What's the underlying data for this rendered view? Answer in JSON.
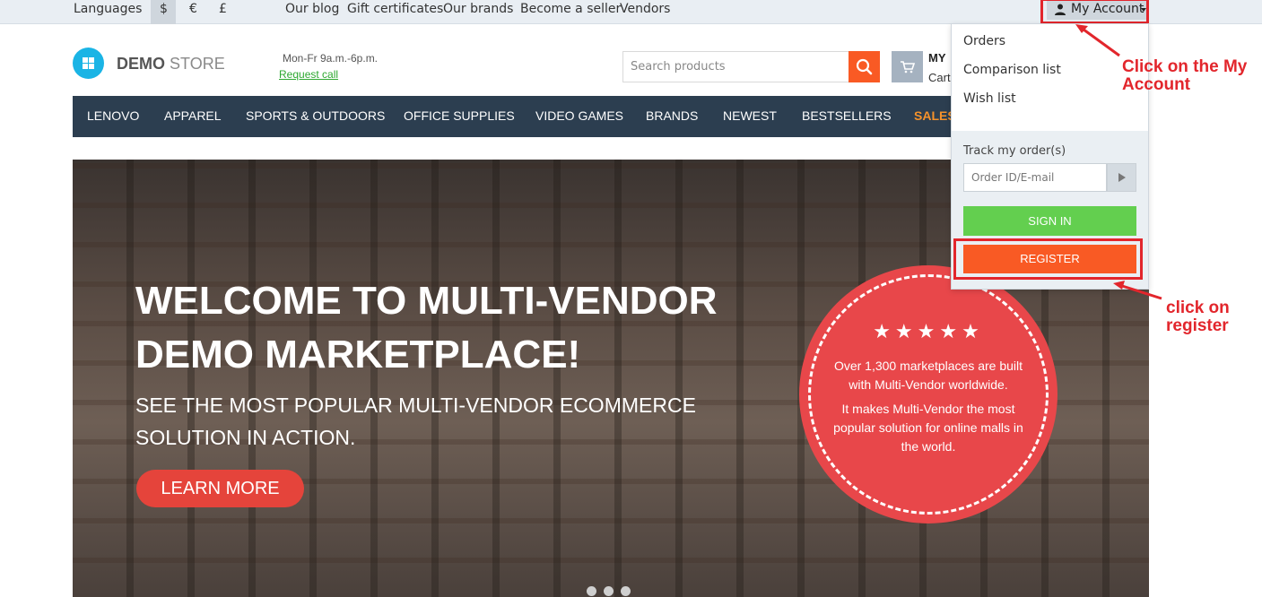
{
  "topbar": {
    "languages": "Languages",
    "currencies": [
      "$",
      "€",
      "£"
    ],
    "links": [
      "Our blog",
      "Gift certificates",
      "Our brands",
      "Become a seller",
      "Vendors"
    ],
    "my_account": "My Account"
  },
  "header": {
    "logo_bold": "DEMO",
    "logo_light": "STORE",
    "hours": "Mon-Fr 9a.m.-6p.m.",
    "request_call": "Request call",
    "search_placeholder": "Search products",
    "cart_title": "MY",
    "cart_sub": "Cart"
  },
  "nav": [
    "LENOVO",
    "APPAREL",
    "SPORTS & OUTDOORS",
    "OFFICE SUPPLIES",
    "VIDEO GAMES",
    "BRANDS",
    "NEWEST",
    "BESTSELLERS",
    "SALES"
  ],
  "hero": {
    "title_line1": "WELCOME TO MULTI-VENDOR",
    "title_line2": "DEMO MARKETPLACE!",
    "subtitle_line1": "SEE THE MOST POPULAR MULTI-VENDOR ECOMMERCE",
    "subtitle_line2": "SOLUTION IN ACTION.",
    "button": "LEARN MORE",
    "badge_stars": "★★★★★",
    "badge_text1": "Over 1,300 marketplaces are built with Multi-Vendor worldwide.",
    "badge_text2": "It makes Multi-Vendor the most popular solution for online malls in the world.",
    "slide_count": 3
  },
  "dropdown": {
    "links": [
      "Orders",
      "Comparison list",
      "Wish list"
    ],
    "track_label": "Track my order(s)",
    "order_placeholder": "Order ID/E-mail",
    "sign_in": "SIGN IN",
    "register": "REGISTER"
  },
  "annotations": {
    "my_account_note_line1": "Click on the My",
    "my_account_note_line2": "Account",
    "register_note_line1": "click on",
    "register_note_line2": "register"
  },
  "colors": {
    "accent_orange": "#f95a24",
    "nav_bg": "#2c3e50",
    "sign_in_green": "#63cf4f",
    "annotation_red": "#e2262c",
    "logo_blue": "#1ab4e5"
  }
}
